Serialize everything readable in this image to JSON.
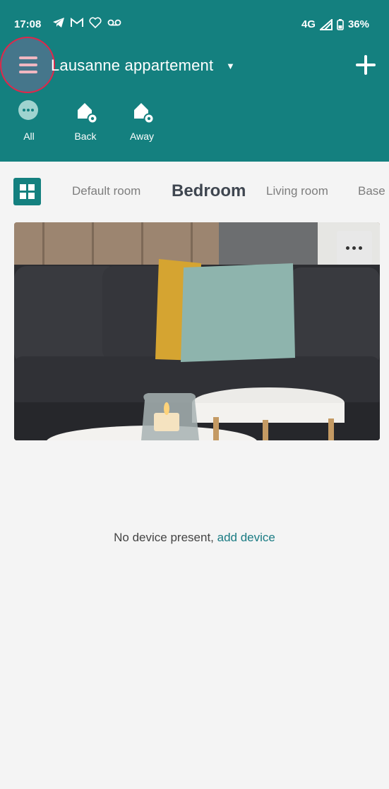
{
  "status_bar": {
    "time": "17:08",
    "network": "4G",
    "battery": "36%",
    "notification_icons": [
      "telegram-icon",
      "gmail-icon",
      "heart-icon",
      "voicemail-icon"
    ]
  },
  "header": {
    "home_name": "Lausanne appartement",
    "caret": "▼",
    "menu_icon": "hamburger-menu-icon",
    "add_icon": "plus-icon",
    "scenes": [
      {
        "label": "All",
        "icon": "more-dots-icon"
      },
      {
        "label": "Back",
        "icon": "home-settings-icon"
      },
      {
        "label": "Away",
        "icon": "home-settings-icon"
      }
    ]
  },
  "rooms": {
    "tabs": [
      "Default room",
      "Bedroom",
      "Living room",
      "Base"
    ],
    "active_tab": "Bedroom"
  },
  "empty_state": {
    "message": "No device present, ",
    "link": "add device"
  },
  "colors": {
    "brand": "#14807f",
    "background": "#f4f4f4",
    "link": "#1a7b83",
    "highlight_ring": "#e0274a"
  }
}
